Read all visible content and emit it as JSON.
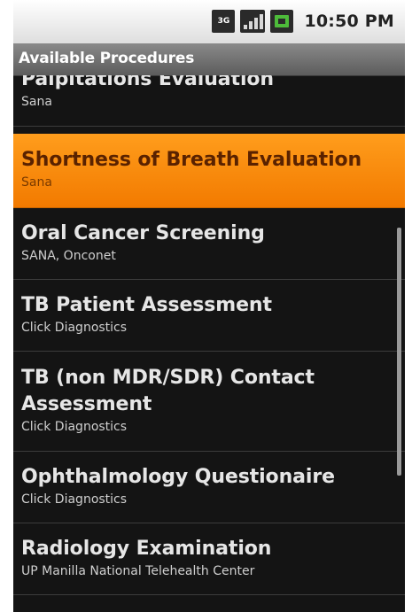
{
  "status_bar": {
    "network_label": "3G",
    "time": "10:50 PM"
  },
  "title_bar": {
    "title": "Available Procedures"
  },
  "procedures": [
    {
      "title": "Palpitations Evaluation",
      "subtitle": "Sana"
    },
    {
      "title": "Shortness of Breath Evaluation",
      "subtitle": "Sana",
      "selected": true
    },
    {
      "title": "Oral Cancer Screening",
      "subtitle": "SANA, Onconet"
    },
    {
      "title": "TB Patient Assessment",
      "subtitle": "Click Diagnostics"
    },
    {
      "title": "TB (non MDR/SDR) Contact Assessment",
      "subtitle": "Click Diagnostics"
    },
    {
      "title": "Ophthalmology Questionaire",
      "subtitle": "Click Diagnostics"
    },
    {
      "title": "Radiology Examination",
      "subtitle": "UP Manilla National Telehealth Center"
    }
  ],
  "colors": {
    "selected_highlight": "#f68a0e",
    "background": "#141414"
  }
}
